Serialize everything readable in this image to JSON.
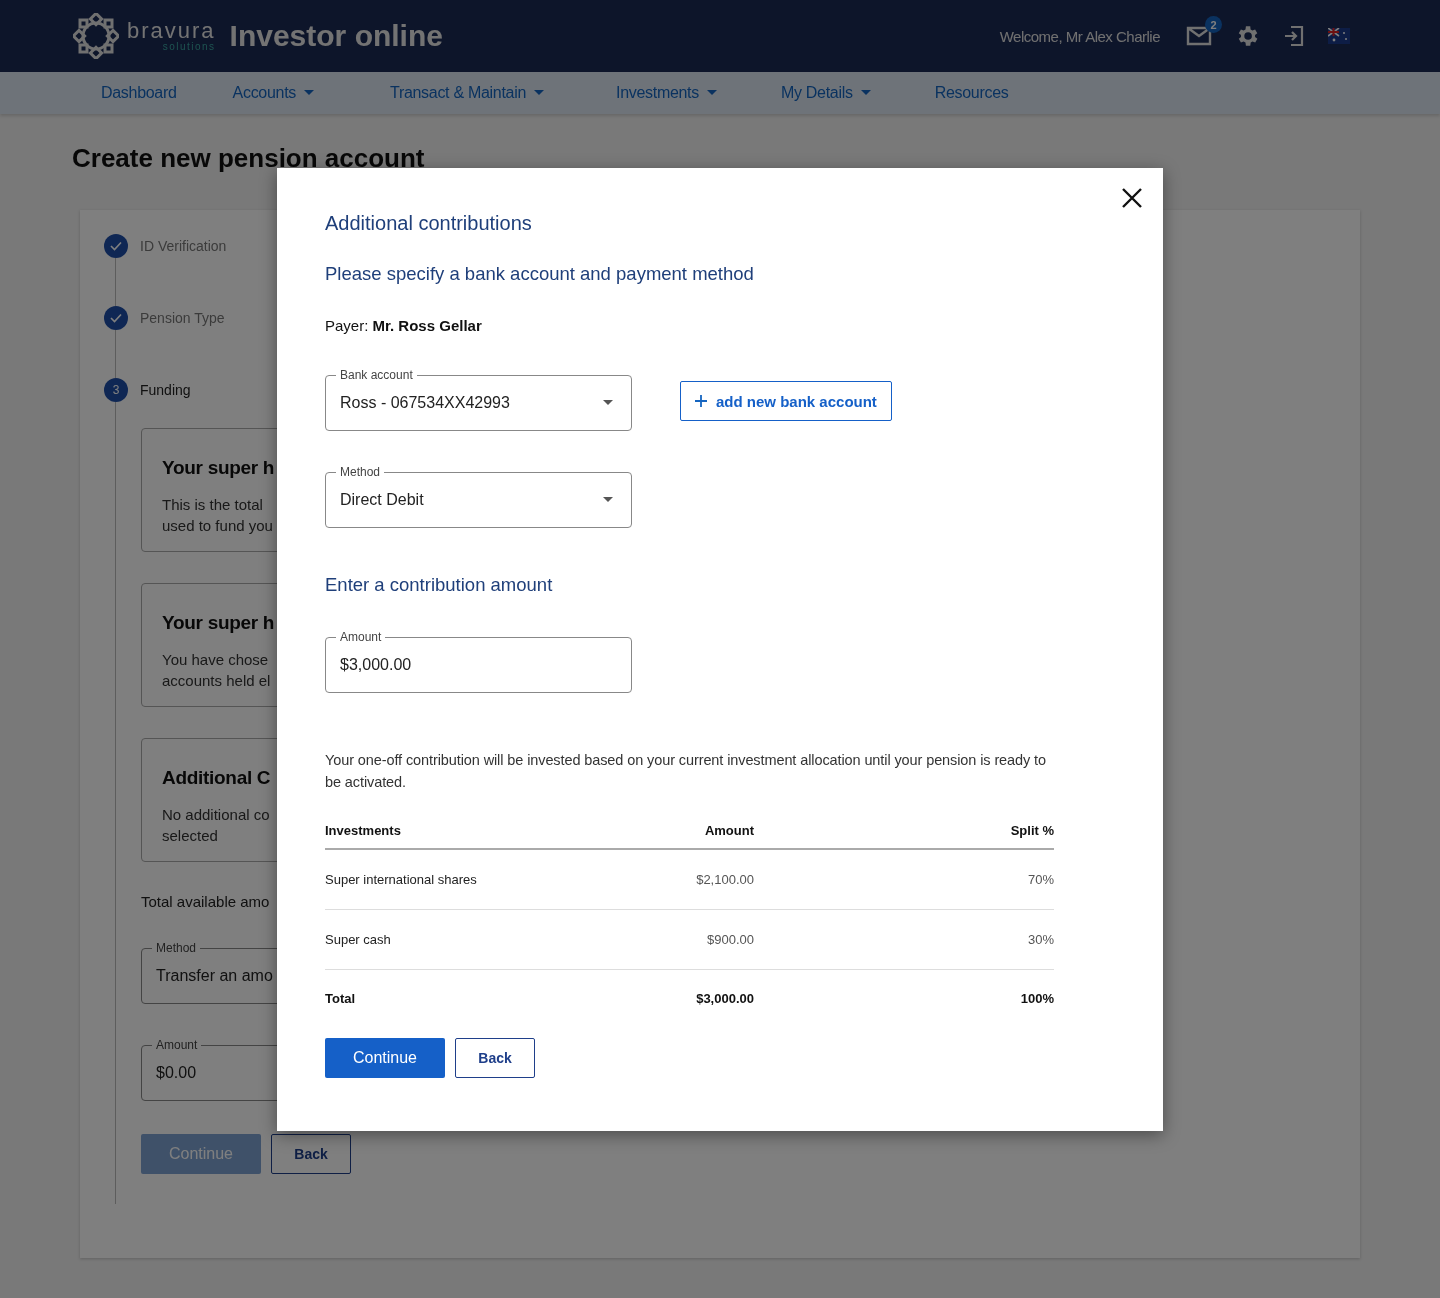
{
  "header": {
    "brand": "bravura",
    "brand_sub": "solutions",
    "title": "Investor online",
    "welcome": "Welcome, Mr Alex Charlie",
    "mail_badge": "2"
  },
  "nav": [
    {
      "label": "Dashboard",
      "dropdown": false
    },
    {
      "label": "Accounts",
      "dropdown": true
    },
    {
      "label": "Transact & Maintain",
      "dropdown": true
    },
    {
      "label": "Investments",
      "dropdown": true
    },
    {
      "label": "My Details",
      "dropdown": true
    },
    {
      "label": "Resources",
      "dropdown": false
    }
  ],
  "page_title": "Create new pension account",
  "steps": [
    {
      "label": "ID Verification",
      "completed": true,
      "active": false
    },
    {
      "label": "Pension Type",
      "completed": true,
      "active": false
    },
    {
      "label": "Funding",
      "completed": false,
      "active": true,
      "number": "3"
    }
  ],
  "summary_cards": [
    {
      "title": "Your super h",
      "lines": [
        "This is the total",
        "used to fund you"
      ]
    },
    {
      "title": "Your super h",
      "lines": [
        "You have chose",
        "accounts held el"
      ]
    },
    {
      "title": "Additional C",
      "lines": [
        "No additional co",
        "selected"
      ]
    }
  ],
  "total_label": "Total available amo",
  "background_fields": [
    {
      "label": "Method",
      "value": "Transfer an amo"
    },
    {
      "label": "Amount",
      "value": "$0.00"
    }
  ],
  "background_buttons": [
    {
      "label": "Continue",
      "disabled": true
    },
    {
      "label": "Back",
      "disabled": false
    }
  ],
  "modal": {
    "title": "Additional contributions",
    "subtitle": "Please specify a bank account and payment method",
    "payer": "Payer: **Mr. Ross Gellar**",
    "bank_account": {
      "label": "Bank account",
      "value": "Ross - 067534XX42993"
    },
    "add_bank": "add new bank account",
    "method": {
      "label": "Method",
      "value": "Direct Debit"
    },
    "amount_heading": "Enter a contribution amount",
    "amount": {
      "label": "Amount",
      "value": "$3,000.00"
    },
    "note": "Your one-off contribution will be invested based on your current investment allocation until your pension is ready to be activated.",
    "table": {
      "columns": [
        "Investments",
        "Amount",
        "Split %"
      ],
      "rows": [
        [
          "Super international shares",
          "$2,100.00",
          "70%"
        ],
        [
          "Super cash",
          "$900.00",
          "30%"
        ]
      ],
      "total": [
        "Total",
        "$3,000.00",
        "100%"
      ]
    },
    "buttons": [
      {
        "label": "Continue",
        "kind": "primary"
      },
      {
        "label": "Back",
        "kind": "secondary"
      }
    ]
  }
}
